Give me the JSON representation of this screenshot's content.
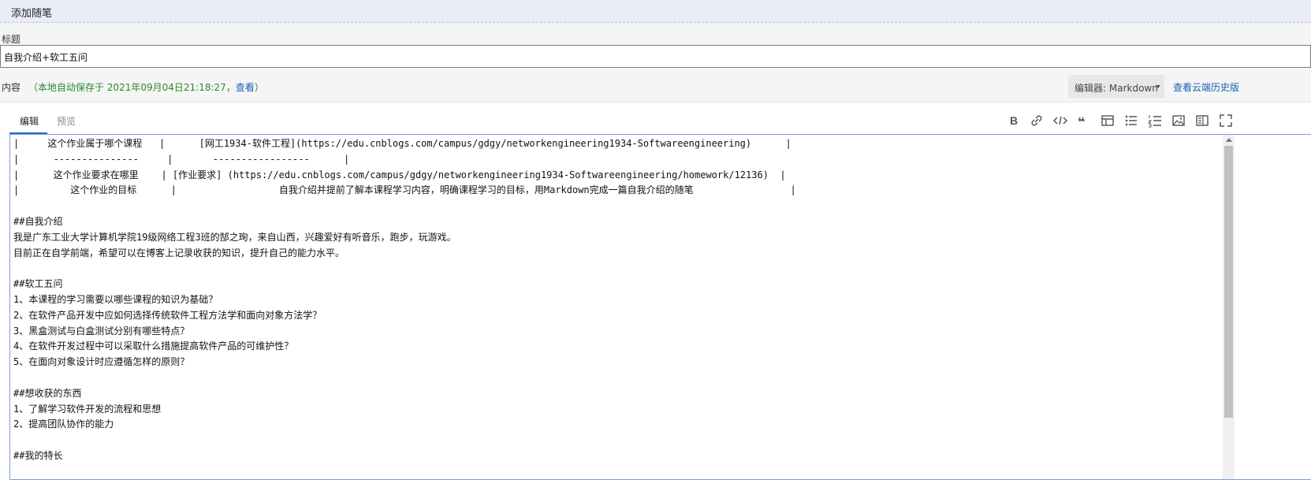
{
  "header": {
    "title": "添加随笔"
  },
  "form": {
    "title_label": "标题",
    "title_value": "自我介绍+软工五问",
    "content_label": "内容",
    "autosave_prefix": "（本地自动保存于 2021年09月04日21:18:27，",
    "autosave_link": "查看",
    "autosave_suffix": "）",
    "editor_switch": "编辑器: Markdown",
    "history_link": "查看云端历史版"
  },
  "tabs": {
    "edit": "编辑",
    "preview": "预览"
  },
  "toolbar": {
    "icons": [
      "bold-icon",
      "link-icon",
      "code-icon",
      "quote-icon",
      "table-icon",
      "unordered-list-icon",
      "ordered-list-icon",
      "image-icon",
      "side-by-side-icon",
      "fullscreen-icon"
    ],
    "bold_glyph": "B",
    "quote_glyph": "❝"
  },
  "editor": {
    "lines": [
      "|     这个作业属于哪个课程   |      [网工1934-软件工程](https://edu.cnblogs.com/campus/gdgy/networkengineering1934-Softwareengineering)      |",
      "|      ---------------     |       -----------------      |",
      "|      这个作业要求在哪里    | [作业要求] (https://edu.cnblogs.com/campus/gdgy/networkengineering1934-Softwareengineering/homework/12136)  |",
      "|         这个作业的目标      |                  自我介绍并提前了解本课程学习内容，明确课程学习的目标，用Markdown完成一篇自我介绍的随笔                 |",
      "",
      "##自我介绍",
      "我是广东工业大学计算机学院19级网络工程3班的郜之珣，来自山西，兴趣爱好有听音乐，跑步，玩游戏。",
      "目前正在自学前端，希望可以在博客上记录收获的知识，提升自己的能力水平。",
      "",
      "##软工五问",
      "1、本课程的学习需要以哪些课程的知识为基础？",
      "2、在软件产品开发中应如何选择传统软件工程方法学和面向对象方法学？",
      "3、黑盒测试与白盒测试分别有哪些特点？",
      "4、在软件开发过程中可以采取什么措施提高软件产品的可维护性？",
      "5、在面向对象设计时应遵循怎样的原则？",
      "",
      "##想收获的东西",
      "1、了解学习软件开发的流程和思想",
      "2、提高团队协作的能力",
      "",
      "##我的特长"
    ]
  }
}
